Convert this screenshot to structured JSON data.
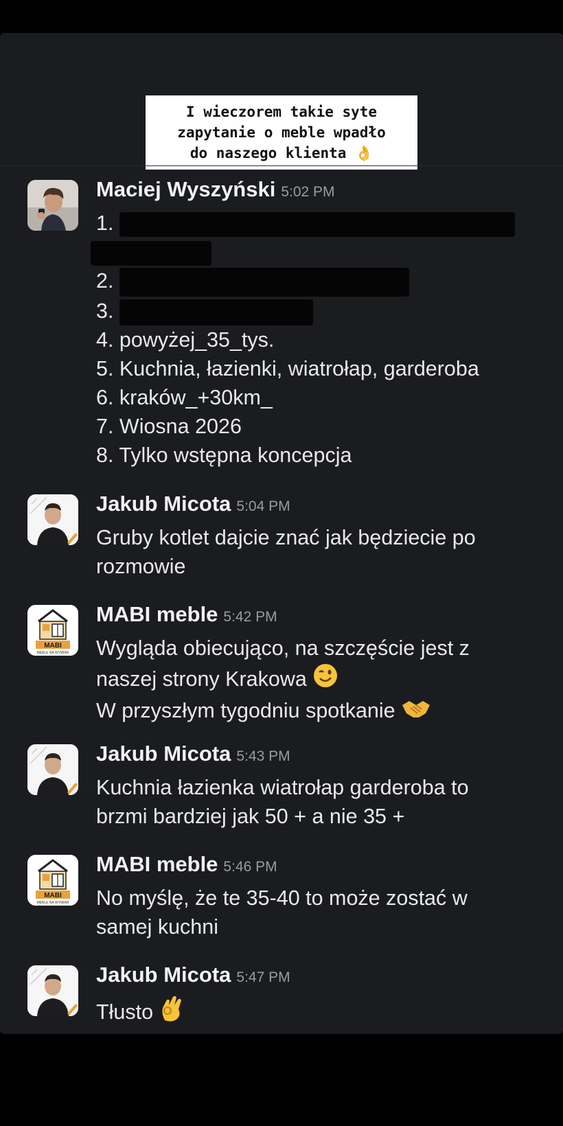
{
  "story_caption": {
    "line1": "I wieczorem takie syte",
    "line2": "zapytanie o meble wpadło",
    "line3": "do naszego klienta 👌"
  },
  "messages": [
    {
      "author": "Maciej Wyszyński",
      "time": "5:02 PM",
      "avatar": "maciej-photo",
      "lines": [
        "1.",
        "2.",
        "3.",
        "4. powyżej_35_tys.",
        "5. Kuchnia, łazienki, wiatrołap, garderoba",
        "6. kraków_+30km_",
        "7. Wiosna 2026",
        "8. Tylko wstępna koncepcja"
      ]
    },
    {
      "author": "Jakub Micota",
      "time": "5:04 PM",
      "avatar": "jakub-photo",
      "lines": [
        "Gruby kotlet dajcie znać jak będziecie po",
        "rozmowie"
      ]
    },
    {
      "author": "MABI meble",
      "time": "5:42 PM",
      "avatar": "mabi-logo",
      "lines": [
        "Wygląda obiecująco, na szczęście jest z",
        "naszej strony Krakowa",
        "W przyszłym tygodniu spotkanie"
      ]
    },
    {
      "author": "Jakub Micota",
      "time": "5:43 PM",
      "avatar": "jakub-photo",
      "lines": [
        "Kuchnia łazienka wiatrołap garderoba to",
        "brzmi bardziej jak 50 + a nie 35 +"
      ]
    },
    {
      "author": "MABI meble",
      "time": "5:46 PM",
      "avatar": "mabi-logo",
      "lines": [
        "No myślę, że te 35-40 to może zostać w",
        "samej kuchni"
      ]
    },
    {
      "author": "Jakub Micota",
      "time": "5:47 PM",
      "avatar": "jakub-photo",
      "lines": [
        "Tłusto"
      ]
    }
  ],
  "logo": {
    "brand_text": "MABI",
    "tagline": "MEBLE NA WYMIAR"
  },
  "colors": {
    "background": "#000000",
    "panel": "#1b1c20",
    "text": "#e9e9ea",
    "timestamp": "#9a9ba0",
    "logo_orange": "#e9a23b"
  },
  "icons": [
    "ok-hand-emoji",
    "winking-face-emoji",
    "handshake-emoji"
  ]
}
